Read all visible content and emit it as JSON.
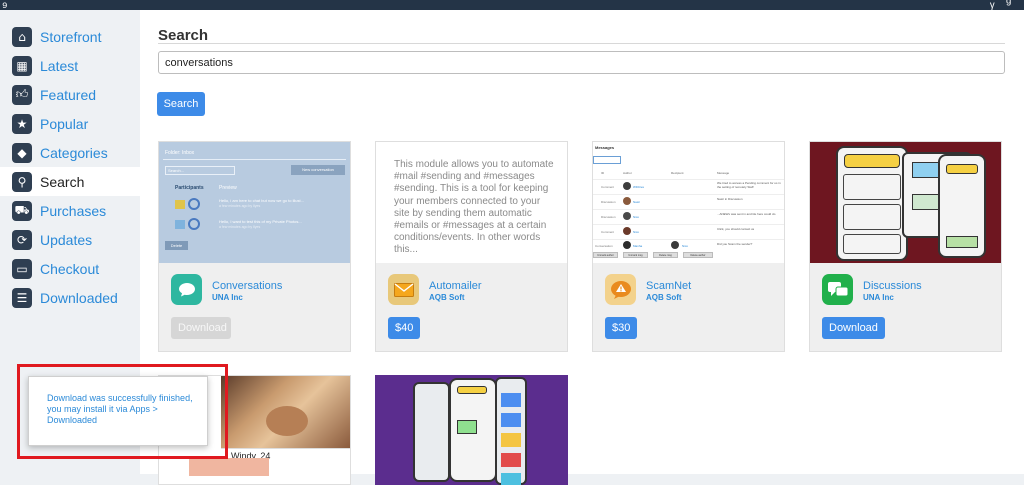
{
  "sidebar": {
    "items": [
      {
        "label": "Storefront",
        "icon": "home-icon"
      },
      {
        "label": "Latest",
        "icon": "grid-icon"
      },
      {
        "label": "Featured",
        "icon": "thumbs-up-icon"
      },
      {
        "label": "Popular",
        "icon": "star-icon"
      },
      {
        "label": "Categories",
        "icon": "tag-icon"
      },
      {
        "label": "Search",
        "icon": "search-icon",
        "active": true
      },
      {
        "label": "Purchases",
        "icon": "cart-icon"
      },
      {
        "label": "Updates",
        "icon": "refresh-icon"
      },
      {
        "label": "Checkout",
        "icon": "credit-card-icon"
      },
      {
        "label": "Downloaded",
        "icon": "list-icon"
      }
    ]
  },
  "main": {
    "title": "Search",
    "search_value": "conversations",
    "search_button": "Search"
  },
  "cards": [
    {
      "name": "Conversations",
      "vendor": "UNA Inc",
      "action": "Download",
      "action_state": "disabled",
      "icon": "chat-bubble-icon",
      "icon_color": "#2eb7a0",
      "thumb": {
        "title": "Folder: Inbox",
        "search_placeholder": "Search...",
        "new_button": "New conversation",
        "col_participants": "Participants",
        "col_preview": "Preview",
        "row1": "Hello, i am here to chat but now we go to illust...",
        "row1_meta": "a few minutes ago by Ilyes",
        "row2": "Hello, I want to test this of my Private Photos...",
        "row2_meta": "a few minutes ago by Ilyes",
        "delete": "Delete"
      }
    },
    {
      "name": "Automailer",
      "vendor": "AQB Soft",
      "action": "$40",
      "action_state": "price",
      "icon": "envelope-icon",
      "icon_color": "#f0a81f",
      "description": "This module allows you to automate #mail #sending and #messages #sending. This is a tool for keeping your members connected to your site by sending them automatic #emails or #messages at a certain conditions/events. In other words this..."
    },
    {
      "name": "ScamNet",
      "vendor": "AQB Soft",
      "action": "$30",
      "action_state": "price",
      "icon": "warning-bubble-icon",
      "icon_color": "#e79a2c",
      "thumb": {
        "title": "Messages",
        "cols": [
          "ID",
          "Author",
          "Recipient",
          "Message"
        ],
        "rows": [
          {
            "id": "1",
            "type": "Comment",
            "author": "WFiltres",
            "recipient": "",
            "msg": "We tried to access a Pending comment for us in the setting of remotely Staff"
          },
          {
            "id": "2",
            "type": "Discussion",
            "author": "Nasir",
            "recipient": "",
            "msg": "Nasir in Discussion"
          },
          {
            "id": "3",
            "type": "Discussion",
            "author": "Nico",
            "recipient": "",
            "msg": "...ANEWs was sent in and tile here could do"
          },
          {
            "id": "4",
            "type": "Comment",
            "author": "Nico",
            "recipient": "",
            "msg": "Click, you should contact us"
          },
          {
            "id": "5",
            "type": "Conversation",
            "author": "Manha",
            "recipient": "Nico",
            "msg": "Did you Scam the sender?"
          }
        ],
        "buttons": [
          "Unmark author",
          "Unmark msg",
          "Delete msg",
          "Delete author"
        ]
      }
    },
    {
      "name": "Discussions",
      "vendor": "UNA Inc",
      "action": "Download",
      "action_state": "enabled",
      "icon": "chat-bubbles-icon",
      "icon_color": "#21b04b"
    },
    {
      "name": "",
      "vendor": "",
      "action": "",
      "action_state": "",
      "icon": "",
      "icon_color": "",
      "thumb": {
        "caption": "Windy, 24"
      }
    },
    {
      "name": "",
      "vendor": "",
      "action": "",
      "action_state": "",
      "icon": "",
      "icon_color": "",
      "thumb": {}
    }
  ],
  "toast": {
    "message": "Download was successfully finished, you may install it via Apps > Downloaded"
  },
  "colors": {
    "accent": "#3d8be8",
    "link": "#2b8ad8",
    "sidebar_bg": "#eef1f4",
    "toast_highlight": "#e0191f",
    "discussions_bg": "#6e1620",
    "purple_bg": "#5b2d8e"
  }
}
